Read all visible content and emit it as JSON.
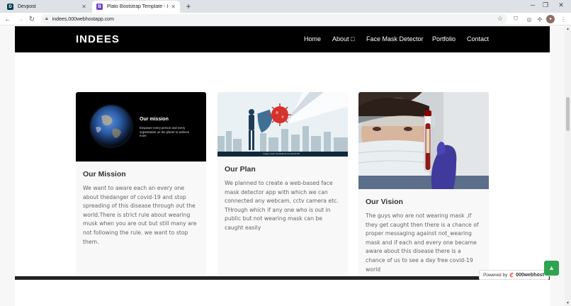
{
  "browser": {
    "tabs": [
      {
        "title": "Devpost",
        "favicon_color": "#003e54",
        "favicon_letter": "D"
      },
      {
        "title": "Plato Bootstrap Template - Index",
        "favicon_color": "#6f42c1",
        "favicon_letter": "B"
      }
    ],
    "url": "indees.000webhostapp.com"
  },
  "site": {
    "brand": "INDEES",
    "nav": {
      "home": "Home",
      "about": "About □",
      "face_mask": "Face Mask Detector",
      "portfolio": "Portfolio",
      "contact": "Contact"
    },
    "cards": [
      {
        "image_heading": "Our mission",
        "image_text": "Empower every person and every organization on the planet to achieve more",
        "title": "Our Mission",
        "text": "We want to aware each an every one about thedanger of covid-19 and stop spreading of this disease through out the world.There is strict rule about wearing musk when you are out but still many are not following the rule. we want to stop them."
      },
      {
        "image_credit": "Image credit: istockphoto.com/etc/0170",
        "title": "Our Plan",
        "text": "We planned to create a web-based face mask detector app with which we can connected any webcam, cctv camera etc. THrough which if any one who is out in public but not wearing mask can be caught easily"
      },
      {
        "title": "Our Vision",
        "text": "The guys who are not wearing mask ,if they get caught then there is a chance of proper messaging against not_wearing mask and if each and every one became aware about this disease there is a chance of us to see a day free covid-19 world"
      }
    ],
    "powered_by": "Powered by",
    "powered_brand": "000webhost"
  },
  "colors": {
    "nav_bg": "#000000",
    "accent_green": "#2ea44f",
    "webhost_orange": "#e8491d"
  }
}
